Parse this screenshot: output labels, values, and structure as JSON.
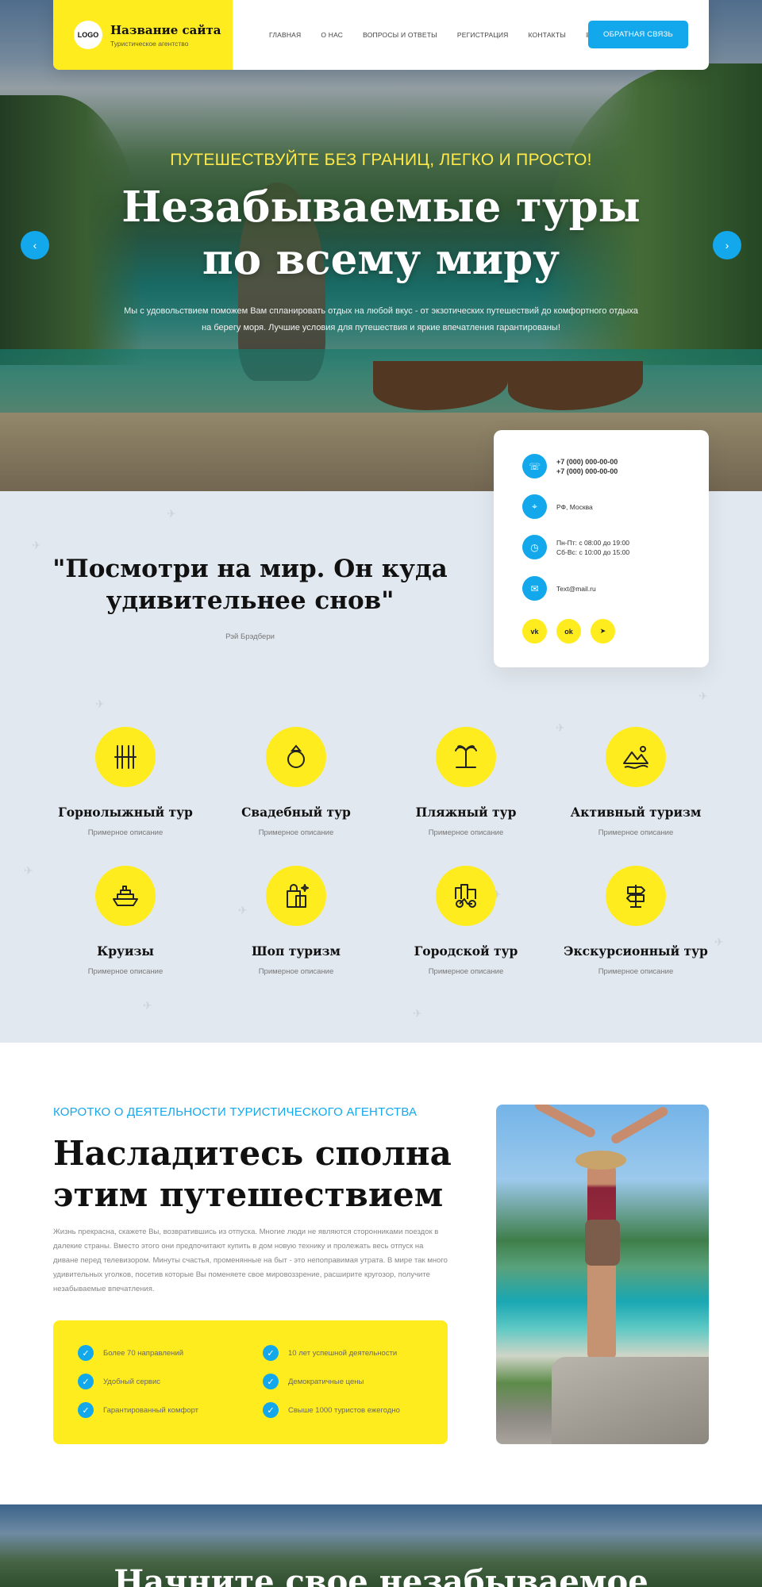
{
  "header": {
    "logo_text": "LOGO",
    "site_name": "Название сайта",
    "site_tagline": "Туристическое агентство",
    "nav": [
      "ГЛАВНАЯ",
      "О НАС",
      "ВОПРОСЫ И ОТВЕТЫ",
      "РЕГИСТРАЦИЯ",
      "КОНТАКТЫ"
    ],
    "menu_icon": "≡",
    "cta_label": "ОБРАТНАЯ СВЯЗЬ"
  },
  "hero": {
    "kicker": "ПУТЕШЕСТВУЙТЕ БЕЗ ГРАНИЦ, ЛЕГКО И ПРОСТО!",
    "title_line1": "Незабываемые туры",
    "title_line2": "по всему миру",
    "text": "Мы с удовольствием поможем Вам спланировать отдых на любой вкус - от экзотических путешествий до комфортного отдыха на берегу моря. Лучшие условия для путешествия и яркие впечатления гарантированы!",
    "prev_icon": "‹",
    "next_icon": "›"
  },
  "contact": {
    "phone1": "+7 (000) 000-00-00",
    "phone2": "+7 (000) 000-00-00",
    "address": "РФ, Москва",
    "hours1": "Пн-Пт: с 08:00 до 19:00",
    "hours2": "Сб-Вс: с 10:00 до 15:00",
    "email": "Text@mail.ru",
    "socials": [
      "vk",
      "ok",
      "tg"
    ]
  },
  "quote": {
    "text": "\"Посмотри на мир. Он куда удивительнее снов\"",
    "author": "Рэй Брэдбери"
  },
  "services": [
    {
      "title": "Горнолыжный тур",
      "desc": "Примерное описание",
      "icon": "ski-icon"
    },
    {
      "title": "Свадебный тур",
      "desc": "Примерное описание",
      "icon": "ring-icon"
    },
    {
      "title": "Пляжный тур",
      "desc": "Примерное описание",
      "icon": "palm-icon"
    },
    {
      "title": "Активный туризм",
      "desc": "Примерное описание",
      "icon": "mountain-icon"
    },
    {
      "title": "Круизы",
      "desc": "Примерное описание",
      "icon": "ship-icon"
    },
    {
      "title": "Шоп туризм",
      "desc": "Примерное описание",
      "icon": "shopping-bag-icon"
    },
    {
      "title": "Городской тур",
      "desc": "Примерное описание",
      "icon": "city-bike-icon"
    },
    {
      "title": "Экскурсионный тур",
      "desc": "Примерное описание",
      "icon": "signpost-icon"
    }
  ],
  "about": {
    "kicker": "КОРОТКО О ДЕЯТЕЛЬНОСТИ ТУРИСТИЧЕСКОГО АГЕНТСТВА",
    "title_line1": "Насладитесь сполна",
    "title_line2": "этим путешествием",
    "text": "Жизнь прекрасна, скажете Вы, возвратившись из отпуска. Многие люди не являются сторонниками поездок в далекие страны. Вместо этого они предпочитают купить в дом новую технику и пролежать весь отпуск на диване перед телевизором. Минуты счастья, променянные на быт - это непоправимая утрата. В мире так много удивительных уголков, посетив которые Вы поменяете свое мировоззрение, расширите кругозор, получите незабываемые впечатления.",
    "features": [
      "Более 70 направлений",
      "10 лет успешной деятельности",
      "Удобный сервис",
      "Демократичные цены",
      "Гарантированный комфорт",
      "Свыше 1000 туристов ежегодно"
    ]
  },
  "bottom": {
    "title": "Начните свое незабываемое"
  },
  "colors": {
    "accent_yellow": "#ffec1f",
    "accent_blue": "#13a8ec",
    "pattern_bg": "#e2e8ef"
  }
}
